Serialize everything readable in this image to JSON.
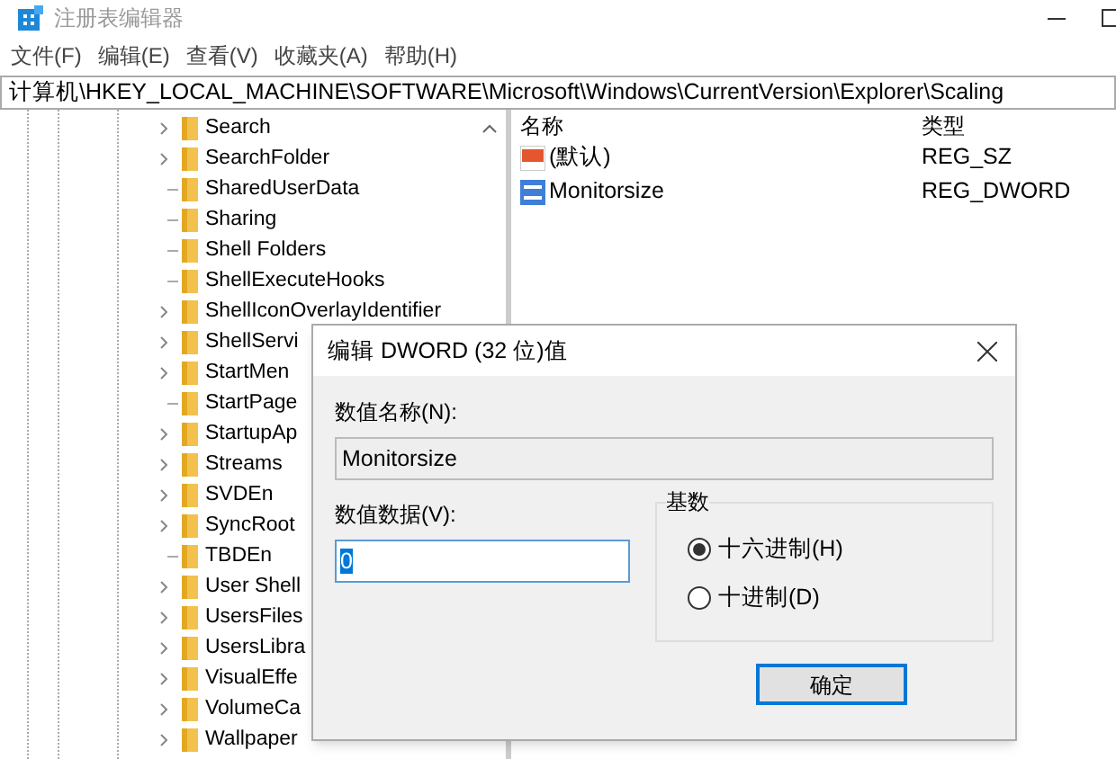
{
  "window": {
    "title": "注册表编辑器"
  },
  "menu": [
    "文件(F)",
    "编辑(E)",
    "查看(V)",
    "收藏夹(A)",
    "帮助(H)"
  ],
  "address": "计算机\\HKEY_LOCAL_MACHINE\\SOFTWARE\\Microsoft\\Windows\\CurrentVersion\\Explorer\\Scaling",
  "tree": [
    {
      "label": "Search",
      "has_children": true
    },
    {
      "label": "SearchFolder",
      "has_children": true
    },
    {
      "label": "SharedUserData",
      "has_children": false
    },
    {
      "label": "Sharing",
      "has_children": false
    },
    {
      "label": "Shell Folders",
      "has_children": false
    },
    {
      "label": "ShellExecuteHooks",
      "has_children": false
    },
    {
      "label": "ShellIconOverlayIdentifier",
      "has_children": true
    },
    {
      "label": "ShellServi",
      "has_children": true
    },
    {
      "label": "StartMen",
      "has_children": true
    },
    {
      "label": "StartPage",
      "has_children": false
    },
    {
      "label": "StartupAp",
      "has_children": true
    },
    {
      "label": "Streams",
      "has_children": true
    },
    {
      "label": "SVDEn",
      "has_children": true
    },
    {
      "label": "SyncRoot",
      "has_children": true
    },
    {
      "label": "TBDEn",
      "has_children": false
    },
    {
      "label": "User Shell",
      "has_children": true
    },
    {
      "label": "UsersFiles",
      "has_children": true
    },
    {
      "label": "UsersLibra",
      "has_children": true
    },
    {
      "label": "VisualEffe",
      "has_children": true
    },
    {
      "label": "VolumeCa",
      "has_children": true
    },
    {
      "label": "Wallpaper",
      "has_children": true
    }
  ],
  "values": {
    "columns": [
      "名称",
      "类型"
    ],
    "rows": [
      {
        "kind": "string",
        "name": "(默认)",
        "type": "REG_SZ"
      },
      {
        "kind": "binary",
        "name": "Monitorsize",
        "type": "REG_DWORD"
      }
    ]
  },
  "dialog": {
    "title": "编辑 DWORD (32 位)值",
    "name_label": "数值名称(N):",
    "name_value": "Monitorsize",
    "data_label": "数值数据(V):",
    "data_value": "0",
    "base_label": "基数",
    "bases": [
      {
        "label": "十六进制(H)",
        "selected": true
      },
      {
        "label": "十进制(D)",
        "selected": false
      }
    ],
    "ok": "确定"
  }
}
